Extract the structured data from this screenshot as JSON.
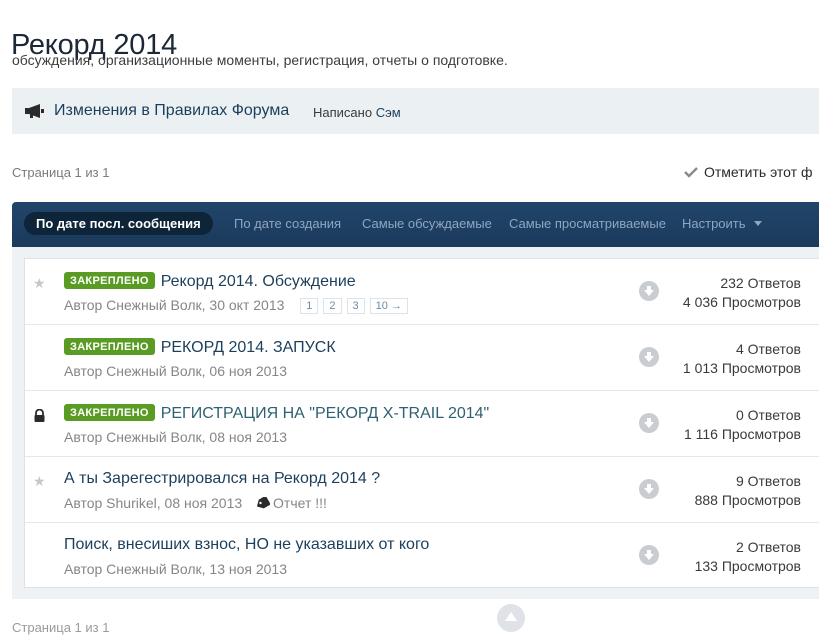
{
  "page": {
    "title": "Рекорд 2014",
    "description": "обсуждения, организационные моменты, регистрация, отчеты о подготовке."
  },
  "announcement": {
    "icon": "megaphone-icon",
    "title": "Изменения в Правилах Форума",
    "by_label": "Написано",
    "author": "Сэм"
  },
  "pagination": {
    "text": "Страница 1 из 1"
  },
  "mark_read": {
    "label": "Отметить этот ф"
  },
  "sort_tabs": [
    {
      "label": "По дате посл. сообщения",
      "active": true
    },
    {
      "label": "По дате создания"
    },
    {
      "label": "Самые обсуждаемые"
    },
    {
      "label": "Самые просматриваемые"
    },
    {
      "label": "Настроить",
      "has_caret": true
    }
  ],
  "topics": [
    {
      "lead_icon": "star-icon",
      "pinned_label": "ЗАКРЕПЛЕНО",
      "title": "Рекорд 2014. Обсуждение",
      "meta": "Автор Снежный Волк, 30 окт 2013",
      "pages": [
        "1",
        "2",
        "3",
        "10 →"
      ],
      "replies": "232 Ответов",
      "views": "4 036 Просмотров"
    },
    {
      "lead_icon": "",
      "pinned_label": "ЗАКРЕПЛЕНО",
      "title": "РЕКОРД 2014. ЗАПУСК",
      "meta": "Автор Снежный Волк, 06 ноя 2013",
      "replies": "4 Ответов",
      "views": "1 013 Просмотров"
    },
    {
      "lead_icon": "lock-icon",
      "pinned_label": "ЗАКРЕПЛЕНО",
      "title": "РЕГИСТРАЦИЯ НА \"РЕКОРД X-TRAIL 2014\"",
      "meta": "Автор Снежный Волк, 08 ноя 2013",
      "replies": "0 Ответов",
      "views": "1 116 Просмотров"
    },
    {
      "lead_icon": "star-icon",
      "title": "А ты Зарегестрировался на Рекорд 2014 ?",
      "meta": "Автор Shurikel, 08 ноя 2013",
      "tag": "Отчет !!!",
      "replies": "9 Ответов",
      "views": "888 Просмотров"
    },
    {
      "lead_icon": "",
      "title": "Поиск, внесиших взнос, НО не указавших от кого",
      "meta": "Автор Снежный Волк, 13 ноя 2013",
      "replies": "2 Ответов",
      "views": "133 Просмотров"
    }
  ],
  "footer": {
    "text": "Страница 1 из 1"
  },
  "colors": {
    "link": "#1c3f5c",
    "pinned_badge": "#5a9b23",
    "tab_bar": "#1b3a5c"
  }
}
